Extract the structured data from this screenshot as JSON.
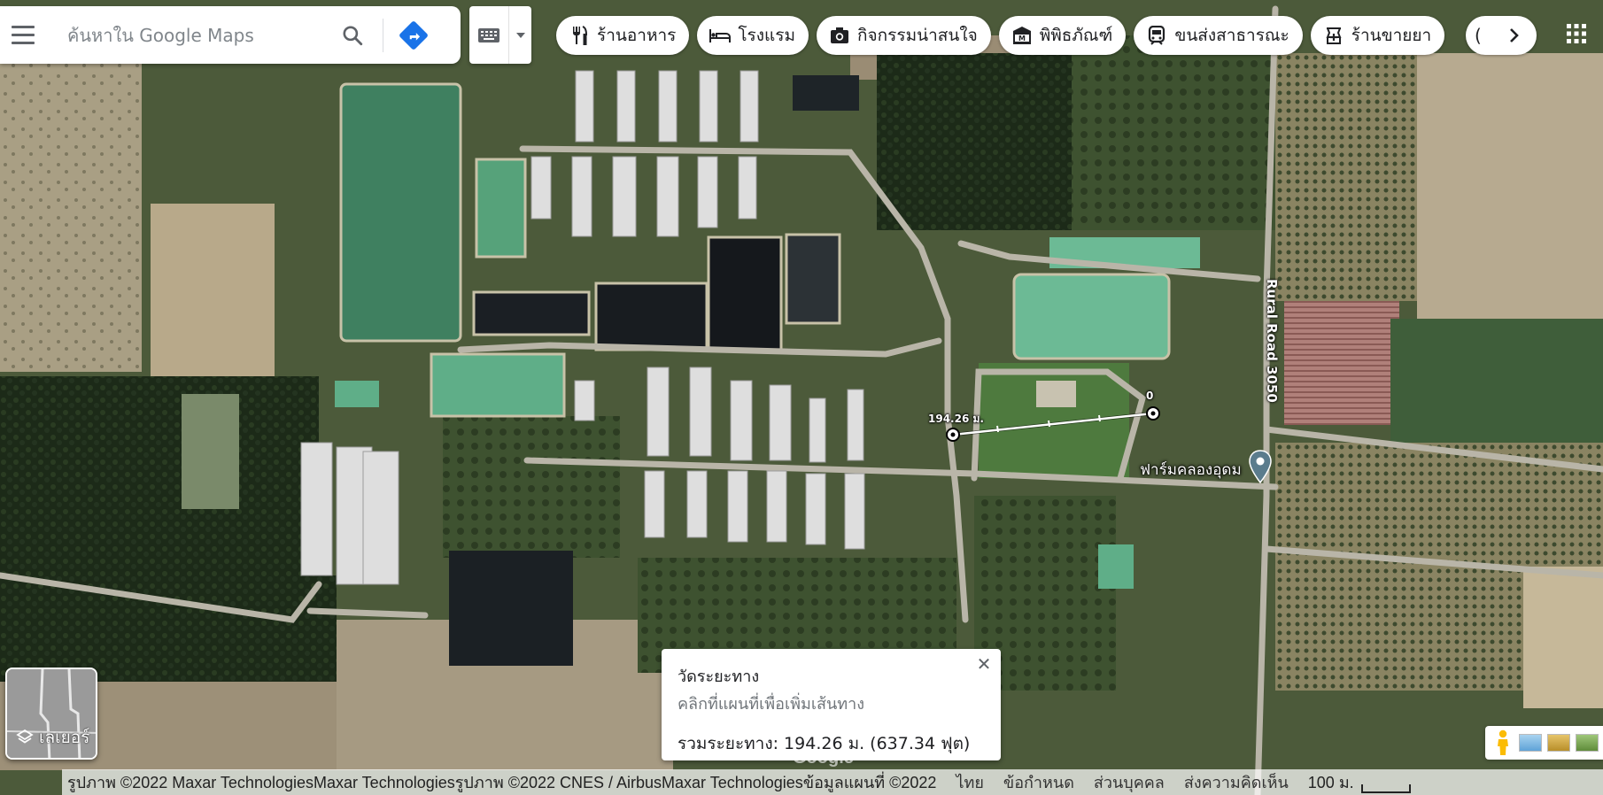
{
  "search": {
    "placeholder": "ค้นหาใน Google Maps"
  },
  "chips": [
    {
      "icon": "restaurant-icon",
      "label": "ร้านอาหาร"
    },
    {
      "icon": "hotel-icon",
      "label": "โรงแรม"
    },
    {
      "icon": "camera-icon",
      "label": "กิจกรรมน่าสนใจ"
    },
    {
      "icon": "museum-icon",
      "label": "พิพิธภัณฑ์"
    },
    {
      "icon": "transit-icon",
      "label": "ขนส่งสาธารณะ"
    },
    {
      "icon": "pharmacy-icon",
      "label": "ร้านขายยา"
    }
  ],
  "map": {
    "road_label": "Rural Road 3050",
    "place_label": "ฟาร์มคลองอุดม",
    "measure_start_label": "0",
    "measure_end_label": "194.26 ม."
  },
  "measure_panel": {
    "title": "วัดระยะทาง",
    "subtitle": "คลิกที่แผนที่เพื่อเพิ่มเส้นทาง",
    "total": "รวมระยะทาง: 194.26 ม. (637.34 ฟุต)"
  },
  "layers": {
    "label": "เลเยอร์"
  },
  "attribution": {
    "copyright": "รูปภาพ ©2022 Maxar TechnologiesMaxar Technologiesรูปภาพ ©2022 CNES / AirbusMaxar Technologiesข้อมูลแผนที่ ©2022",
    "links": [
      "ไทย",
      "ข้อกำหนด",
      "ส่วนบุคคล",
      "ส่งความคิดเห็น"
    ],
    "scale": "100 ม."
  },
  "watermark": "Google",
  "colors": {
    "accent_blue": "#1a73e8",
    "chip_text": "#202124",
    "pin": "#5b7c8d"
  }
}
